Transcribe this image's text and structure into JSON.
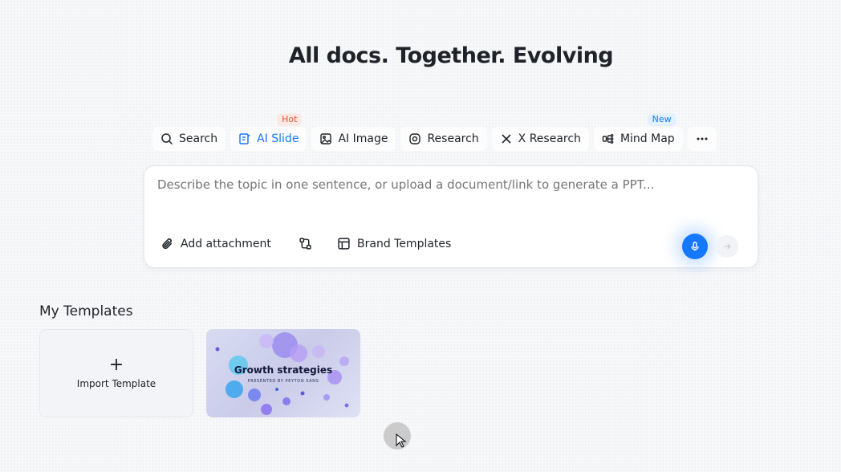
{
  "header": {
    "title": "All docs. Together. Evolving"
  },
  "tabs": [
    {
      "label": "Search",
      "icon": "search-icon"
    },
    {
      "label": "AI Slide",
      "icon": "ai-slide-icon",
      "badge": "Hot",
      "active": true
    },
    {
      "label": "AI Image",
      "icon": "image-icon"
    },
    {
      "label": "Research",
      "icon": "research-icon"
    },
    {
      "label": "X Research",
      "icon": "x-icon"
    },
    {
      "label": "Mind Map",
      "icon": "mind-map-icon",
      "badge": "New"
    }
  ],
  "composer": {
    "placeholder": "Describe the topic in one sentence, or upload a document/link to generate a PPT...",
    "add_attachment": "Add attachment",
    "brand_templates": "Brand Templates"
  },
  "templates": {
    "section_title": "My Templates",
    "import_label": "Import Template",
    "import_icon": "+",
    "card_title": "Growth strategies",
    "card_subtitle": "PRESENTED BY PEYTON SANS"
  },
  "colors": {
    "accent": "#1677ff",
    "hot": "#e5533a"
  }
}
